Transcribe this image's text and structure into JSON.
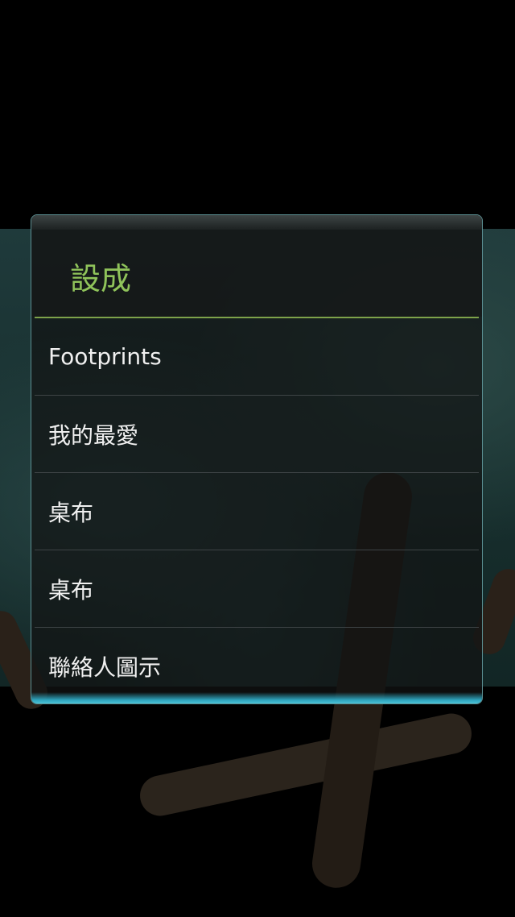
{
  "dialog": {
    "title": "設成",
    "options": [
      {
        "label": "Footprints"
      },
      {
        "label": "我的最愛"
      },
      {
        "label": "桌布"
      },
      {
        "label": "桌布"
      },
      {
        "label": "聯絡人圖示"
      }
    ]
  },
  "colors": {
    "title": "#8fc35a",
    "divider": "#7da24a",
    "accent_bottom": "#4cc2d6"
  }
}
